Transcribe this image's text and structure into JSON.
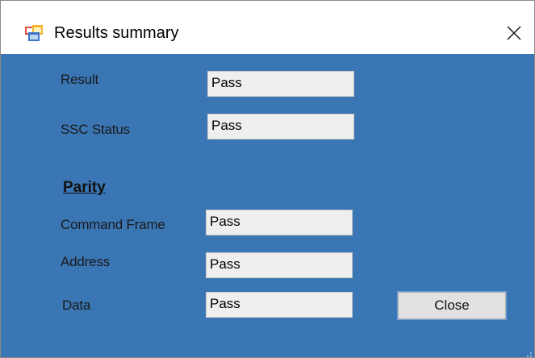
{
  "window": {
    "title": "Results summary",
    "icon": "app-window-icon",
    "close_icon": "close-icon",
    "background_color": "#3a76b4"
  },
  "fields": {
    "result": {
      "label": "Result",
      "value": "Pass"
    },
    "ssc_status": {
      "label": "SSC Status",
      "value": "Pass"
    }
  },
  "parity": {
    "heading": "Parity",
    "command_frame": {
      "label": "Command Frame",
      "value": "Pass"
    },
    "address": {
      "label": "Address",
      "value": "Pass"
    },
    "data": {
      "label": "Data",
      "value": "Pass"
    }
  },
  "buttons": {
    "close_label": "Close"
  }
}
